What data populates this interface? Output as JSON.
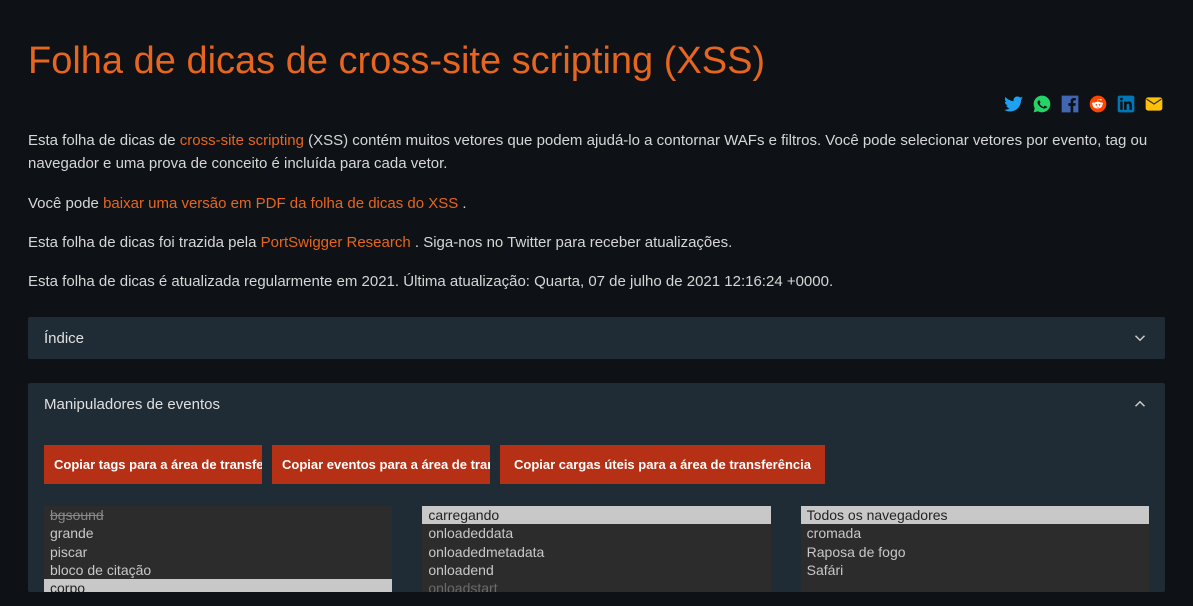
{
  "page": {
    "title": "Folha de dicas de cross-site scripting (XSS)"
  },
  "intro": {
    "p1_a": "Esta folha de dicas de ",
    "p1_link": "cross-site scripting",
    "p1_b": " (XSS) contém muitos vetores que podem ajudá-lo a contornar WAFs e filtros. Você pode selecionar vetores por evento, tag ou navegador e uma prova de conceito é incluída para cada vetor.",
    "p2_a": "Você pode ",
    "p2_link": "baixar uma versão em PDF da folha de dicas do XSS",
    "p2_b": " .",
    "p3_a": "Esta folha de dicas foi trazida pela ",
    "p3_link": "PortSwigger Research",
    "p3_b": " . Siga-nos no Twitter para receber atualizações.",
    "p4": "Esta folha de dicas é atualizada regularmente em 2021. Última atualização: Quarta, 07 de julho de 2021 12:16:24 +0000."
  },
  "panels": {
    "index": {
      "title": "Índice"
    },
    "handlers": {
      "title": "Manipuladores de eventos"
    }
  },
  "buttons": {
    "copy_tags": "Copiar tags para a área de transferência",
    "copy_events": "Copiar eventos para a área de transferência",
    "copy_payloads": "Copiar cargas úteis para a área de transferência"
  },
  "tags_list": {
    "items": [
      {
        "label": "bgsound",
        "struck": true
      },
      {
        "label": "grande"
      },
      {
        "label": "piscar"
      },
      {
        "label": "bloco de citação"
      },
      {
        "label": "corpo",
        "selected": true
      }
    ]
  },
  "events_list": {
    "items": [
      {
        "label": "carregando",
        "selected": true
      },
      {
        "label": "onloadeddata"
      },
      {
        "label": "onloadedmetadata"
      },
      {
        "label": "onloadend"
      },
      {
        "label": "onloadstart",
        "faded": true
      }
    ]
  },
  "browsers_list": {
    "items": [
      {
        "label": "Todos os navegadores",
        "selected": true
      },
      {
        "label": "cromada"
      },
      {
        "label": "Raposa de fogo"
      },
      {
        "label": "Safári"
      }
    ]
  }
}
